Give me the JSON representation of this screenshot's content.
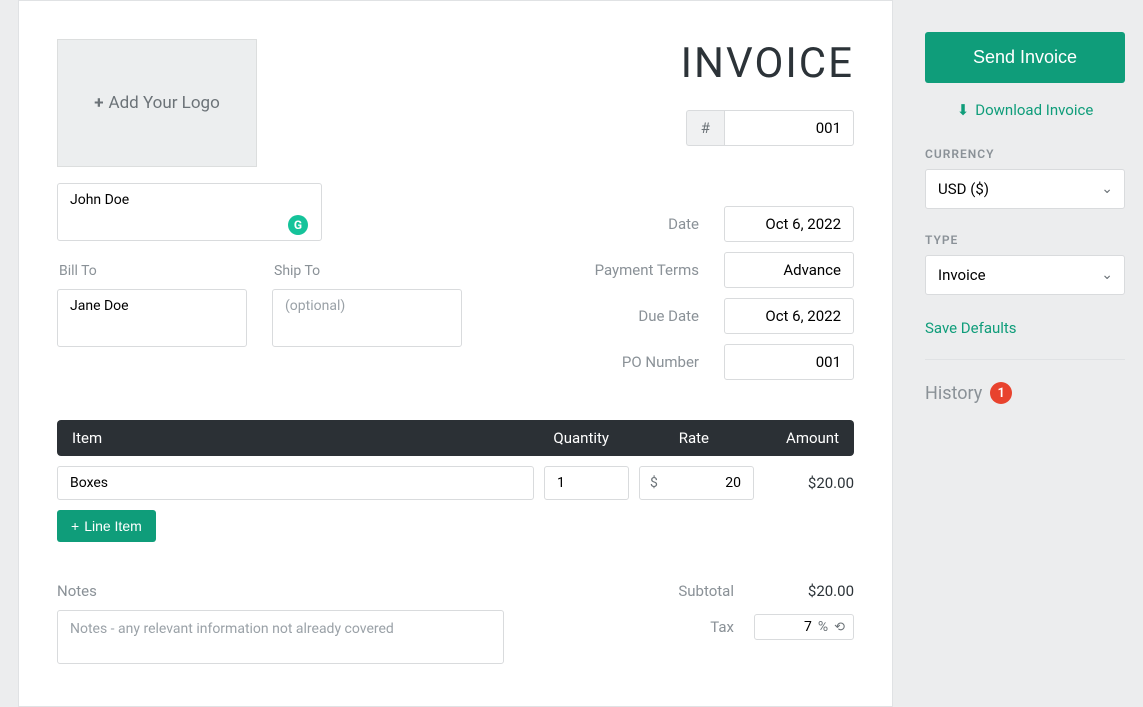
{
  "logo_text": "Add Your Logo",
  "from": "John Doe",
  "bill_to_label": "Bill To",
  "bill_to": "Jane Doe",
  "ship_to_label": "Ship To",
  "ship_to_placeholder": "(optional)",
  "title": "INVOICE",
  "number_prefix": "#",
  "number": "001",
  "meta": {
    "date_label": "Date",
    "date": "Oct 6, 2022",
    "terms_label": "Payment Terms",
    "terms": "Advance",
    "due_label": "Due Date",
    "due": "Oct 6, 2022",
    "po_label": "PO Number",
    "po": "001"
  },
  "headers": {
    "item": "Item",
    "qty": "Quantity",
    "rate": "Rate",
    "amount": "Amount"
  },
  "items": [
    {
      "desc": "Boxes",
      "qty": "1",
      "currency": "$",
      "rate": "20",
      "amount": "$20.00"
    }
  ],
  "add_line_label": "Line Item",
  "notes_label": "Notes",
  "notes_placeholder": "Notes - any relevant information not already covered",
  "totals": {
    "subtotal_label": "Subtotal",
    "subtotal": "$20.00",
    "tax_label": "Tax",
    "tax_value": "7",
    "tax_unit": "%"
  },
  "sidebar": {
    "send": "Send Invoice",
    "download": "Download Invoice",
    "currency_label": "Currency",
    "currency": "USD ($)",
    "type_label": "Type",
    "type": "Invoice",
    "save_defaults": "Save Defaults",
    "history_label": "History",
    "history_count": "1"
  }
}
